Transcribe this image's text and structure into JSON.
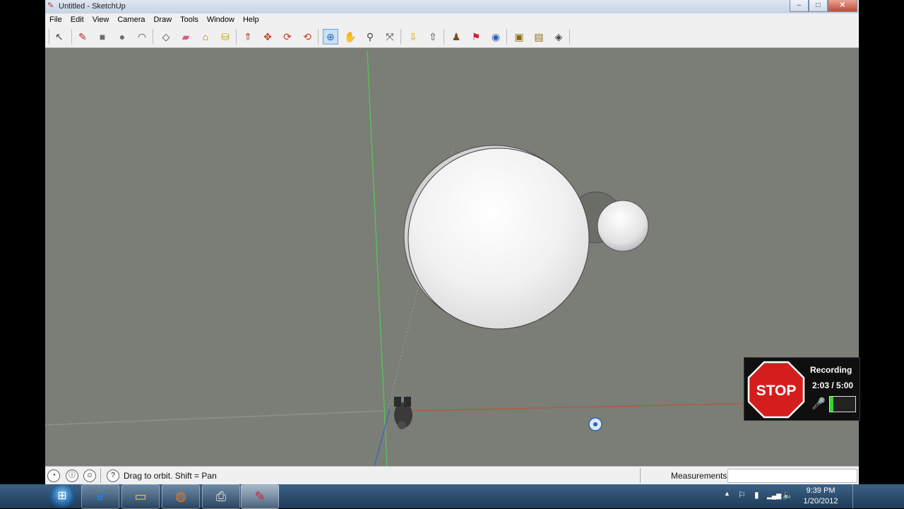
{
  "window": {
    "title": "Untitled - SketchUp",
    "controls": [
      "–",
      "□",
      "✕"
    ]
  },
  "menu": [
    "File",
    "Edit",
    "View",
    "Camera",
    "Draw",
    "Tools",
    "Window",
    "Help"
  ],
  "toolbar": [
    {
      "name": "select-tool-icon",
      "glyph": "↖"
    },
    {
      "name": "pencil-tool-icon",
      "glyph": "✎"
    },
    {
      "name": "rectangle-tool-icon",
      "glyph": "■"
    },
    {
      "name": "circle-tool-icon",
      "glyph": "●"
    },
    {
      "name": "arc-tool-icon",
      "glyph": "◠"
    },
    {
      "name": "make-component-icon",
      "glyph": "◇"
    },
    {
      "name": "eraser-tool-icon",
      "glyph": "▰"
    },
    {
      "name": "tape-measure-icon",
      "glyph": "⌂"
    },
    {
      "name": "paint-bucket-icon",
      "glyph": "⛁"
    },
    {
      "name": "push-pull-icon",
      "glyph": "⇑"
    },
    {
      "name": "move-tool-icon",
      "glyph": "✥"
    },
    {
      "name": "rotate-tool-icon",
      "glyph": "⟳"
    },
    {
      "name": "offset-tool-icon",
      "glyph": "⟲"
    },
    {
      "name": "orbit-tool-icon",
      "glyph": "⊕"
    },
    {
      "name": "pan-tool-icon",
      "glyph": "✋"
    },
    {
      "name": "zoom-tool-icon",
      "glyph": "⚲"
    },
    {
      "name": "zoom-extents-icon",
      "glyph": "⤧"
    },
    {
      "name": "get-models-icon",
      "glyph": "⇩"
    },
    {
      "name": "share-model-icon",
      "glyph": "⇧"
    },
    {
      "name": "position-camera-icon",
      "glyph": "♟"
    },
    {
      "name": "walk-tool-icon",
      "glyph": "⚑"
    },
    {
      "name": "look-around-icon",
      "glyph": "◉"
    },
    {
      "name": "get-components-icon",
      "glyph": "▣"
    },
    {
      "name": "share-component-icon",
      "glyph": "▤"
    },
    {
      "name": "extension-warehouse-icon",
      "glyph": "◈"
    }
  ],
  "status": {
    "hint": "Drag to orbit.  Shift = Pan",
    "measurements_label": "Measurements",
    "measurements_value": ""
  },
  "recorder": {
    "stop_label": "STOP",
    "state": "Recording",
    "elapsed": "2:03",
    "limit": "5:00",
    "level": 0.15
  },
  "taskbar": {
    "apps": [
      {
        "name": "ie-taskbar-button",
        "glyph": "e"
      },
      {
        "name": "explorer-taskbar-button",
        "glyph": "▭"
      },
      {
        "name": "firefox-taskbar-button",
        "glyph": "◍"
      },
      {
        "name": "printer-taskbar-button",
        "glyph": "⎙"
      },
      {
        "name": "sketchup-taskbar-button",
        "glyph": "✎"
      }
    ],
    "tray_icons": [
      "▲",
      "⚐",
      "▮",
      "▂▄▆",
      "🔈"
    ],
    "time": "9:39 PM",
    "date": "1/20/2012"
  },
  "colors": {
    "viewport_bg": "#7a7e77",
    "green_axis": "#56c456",
    "red_axis": "#b9552e",
    "blue_axis": "#3e5cbf"
  }
}
